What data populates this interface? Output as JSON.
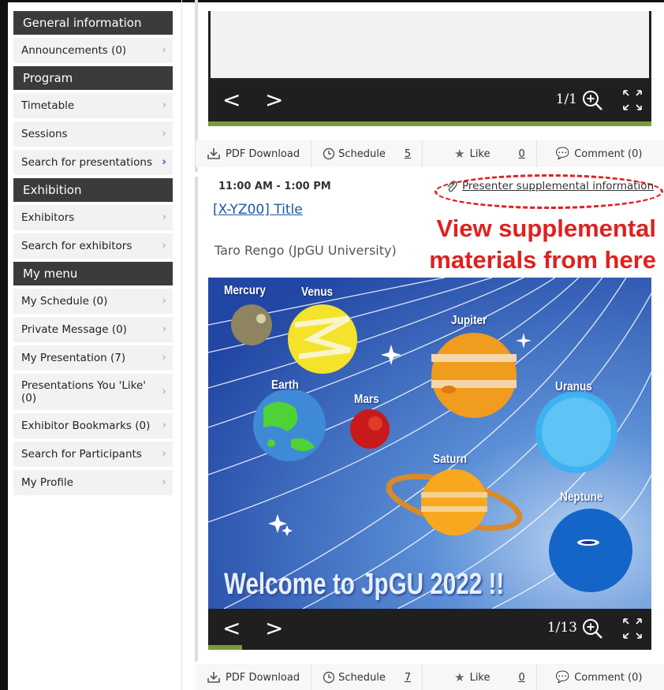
{
  "sidebar": {
    "sections": [
      {
        "title": "General information",
        "items": [
          "Announcements (0)"
        ]
      },
      {
        "title": "Program",
        "items": [
          "Timetable",
          "Sessions",
          "Search for presentations"
        ]
      },
      {
        "title": "Exhibition",
        "items": [
          "Exhibitors",
          "Search for exhibitors"
        ]
      },
      {
        "title": "My menu",
        "items": [
          "My Schedule (0)",
          "Private Message (0)",
          "My Presentation (7)",
          "Presentations You 'Like' (0)",
          "Exhibitor Bookmarks (0)",
          "Search for Participants",
          "My Profile"
        ]
      }
    ]
  },
  "viewer1": {
    "page_count": "1/1",
    "progress": 1.0
  },
  "actions1": {
    "pdf": "PDF Download",
    "schedule": "Schedule",
    "schedule_count": "5",
    "like": "Like",
    "like_count": "0",
    "comment": "Comment (0)"
  },
  "presentation": {
    "time": "11:00 AM - 1:00 PM",
    "supplemental": "Presenter supplemental information",
    "title": "[X-YZ00] Title",
    "presenter": "Taro Rengo (JpGU University)"
  },
  "callout": {
    "line1": "View supplemental",
    "line2": "materials from here"
  },
  "slide": {
    "planets": [
      "Mercury",
      "Venus",
      "Jupiter",
      "Earth",
      "Mars",
      "Uranus",
      "Saturn",
      "Neptune"
    ],
    "welcome": "Welcome to JpGU 2022 !!"
  },
  "viewer2": {
    "page_count": "1/13",
    "progress": 0.077
  },
  "actions2": {
    "pdf": "PDF Download",
    "schedule": "Schedule",
    "schedule_count": "7",
    "like": "Like",
    "like_count": "0",
    "comment": "Comment (0)"
  },
  "colors": {
    "accent": "#1b57a6",
    "callout": "#e02020",
    "progress": "#7b9a3c",
    "header": "#3b3b3b"
  }
}
